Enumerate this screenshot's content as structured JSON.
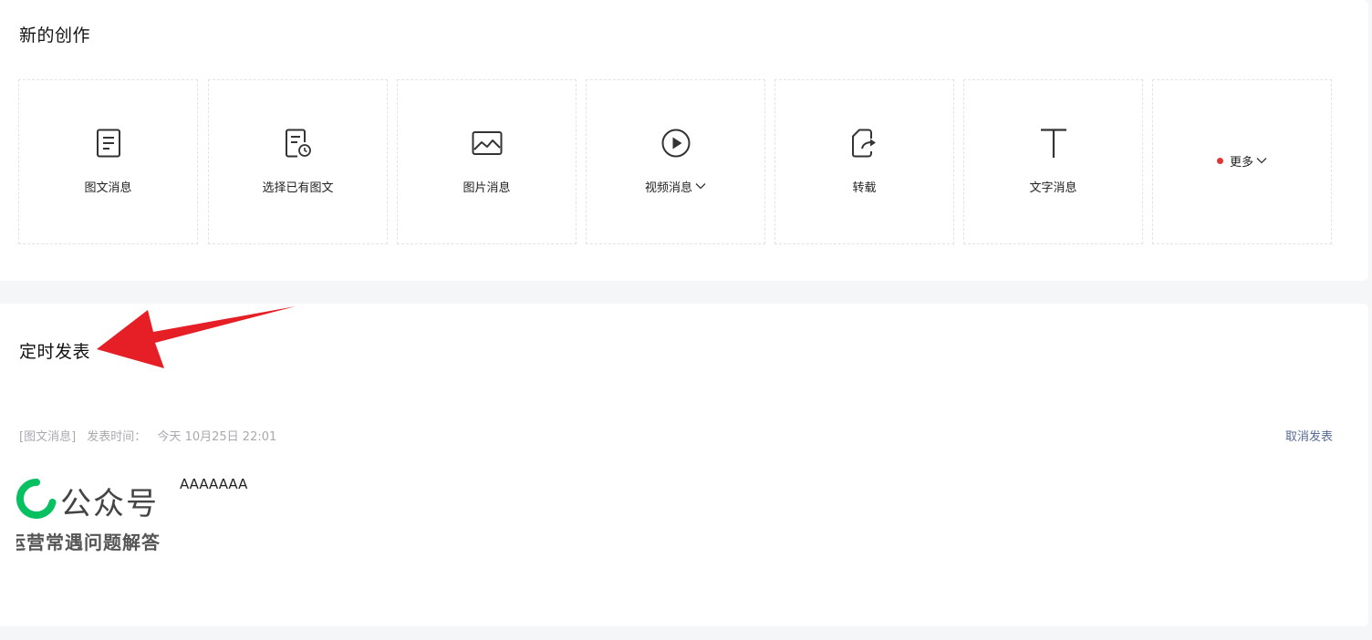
{
  "create": {
    "title": "新的创作",
    "tiles": [
      {
        "label": "图文消息",
        "icon": "document-icon",
        "dropdown": false
      },
      {
        "label": "选择已有图文",
        "icon": "document-clock-icon",
        "dropdown": false
      },
      {
        "label": "图片消息",
        "icon": "image-icon",
        "dropdown": false
      },
      {
        "label": "视频消息",
        "icon": "play-circle-icon",
        "dropdown": true
      },
      {
        "label": "转载",
        "icon": "share-forward-icon",
        "dropdown": false
      },
      {
        "label": "文字消息",
        "icon": "text-t-icon",
        "dropdown": false
      },
      {
        "label": "更多",
        "icon": "red-dot-icon",
        "dropdown": true
      }
    ]
  },
  "schedule": {
    "title": "定时发表",
    "item": {
      "type_tag": "[图文消息]",
      "time_label": "发表时间：",
      "time_value": "今天 10月25日 22:01",
      "cancel_label": "取消发表",
      "thumb_brand": "公众号",
      "thumb_sub": "运营常遇问题解答",
      "article_title": "AAAAAAA"
    }
  },
  "colors": {
    "accent_link": "#576b95",
    "annotation_arrow": "#e61e25",
    "brand_green": "#07c160",
    "notice_dot": "#e23535"
  }
}
